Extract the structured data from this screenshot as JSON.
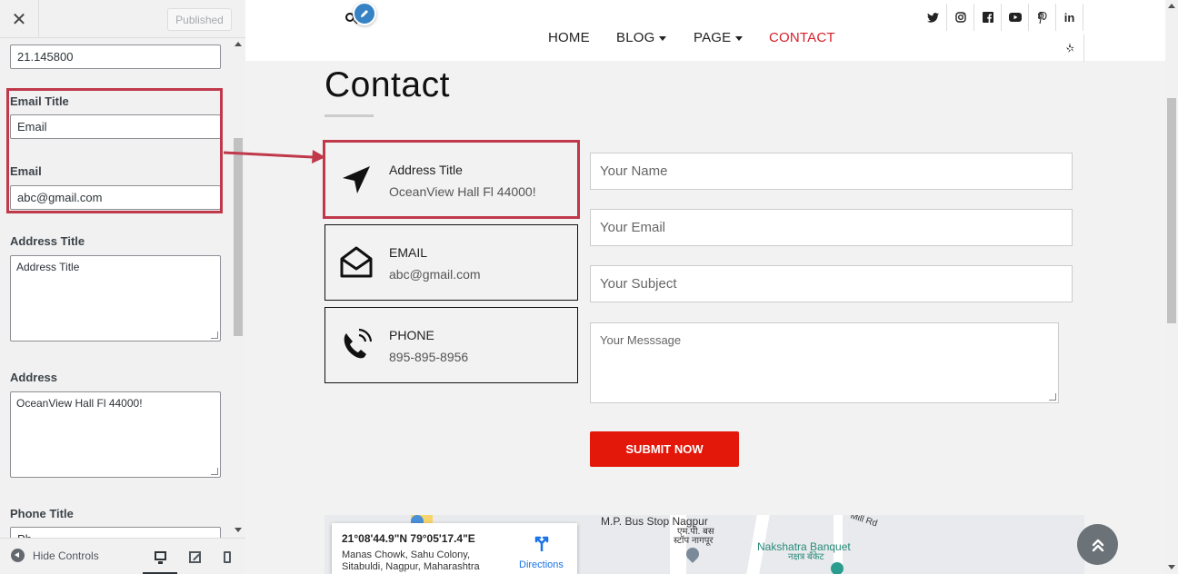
{
  "customizer": {
    "close_icon": "close-icon",
    "publish_label": "Published",
    "fields": {
      "prev_value": "21.145800",
      "email_title_label": "Email Title",
      "email_title_value": "Email",
      "email_label": "Email",
      "email_value": "abc@gmail.com",
      "address_title_label": "Address Title",
      "address_title_value": "Address Title",
      "address_label": "Address",
      "address_value": "OceanView Hall Fl 44000!",
      "phone_title_label": "Phone Title",
      "phone_title_value": "Ph"
    },
    "footer": {
      "hide_controls_label": "Hide Controls",
      "devices": [
        "desktop",
        "tablet",
        "mobile"
      ],
      "active_device": "desktop"
    }
  },
  "site": {
    "nav": [
      {
        "label": "HOME",
        "dropdown": false,
        "active": false
      },
      {
        "label": "BLOG",
        "dropdown": true,
        "active": false
      },
      {
        "label": "PAGE",
        "dropdown": true,
        "active": false
      },
      {
        "label": "CONTACT",
        "dropdown": false,
        "active": true
      }
    ],
    "social_icons": [
      "twitter-icon",
      "instagram-icon",
      "facebook-icon",
      "youtube-icon",
      "pinterest-icon",
      "linkedin-icon",
      "yelp-icon"
    ],
    "social_labels": {
      "linkedin": "in"
    },
    "page_title": "Contact",
    "info_cards": [
      {
        "icon": "navigation-arrow-icon",
        "title": "Address Title",
        "value": "OceanView Hall Fl 44000!"
      },
      {
        "icon": "envelope-open-icon",
        "title": "EMAIL",
        "value": "abc@gmail.com"
      },
      {
        "icon": "phone-ringing-icon",
        "title": "PHONE",
        "value": "895-895-8956"
      }
    ],
    "form": {
      "name_placeholder": "Your Name",
      "email_placeholder": "Your Email",
      "subject_placeholder": "Your Subject",
      "message_placeholder": "Your Messsage",
      "submit_label": "SUBMIT NOW"
    },
    "map": {
      "coords": "21°08'44.9\"N 79°05'17.4\"E",
      "address_line1": "Manas Chowk, Sahu Colony,",
      "address_line2": "Sitabuldi, Nagpur, Maharashtra",
      "directions_label": "Directions",
      "labels": {
        "bus_stop": "M.P. Bus Stop Nagpur",
        "bus_stop_local_1": "एम.पी. बस",
        "bus_stop_local_2": "स्टॉप नागपूर",
        "banquet": "Nakshatra Banquet",
        "banquet_local": "नक्षत्र बँकेट",
        "mill_rd": "Mill Rd"
      }
    }
  },
  "colors": {
    "accent_red": "#e3170a",
    "nav_active": "#d5202a",
    "highlight": "#c0394a",
    "edit_blue": "#3582c4"
  }
}
